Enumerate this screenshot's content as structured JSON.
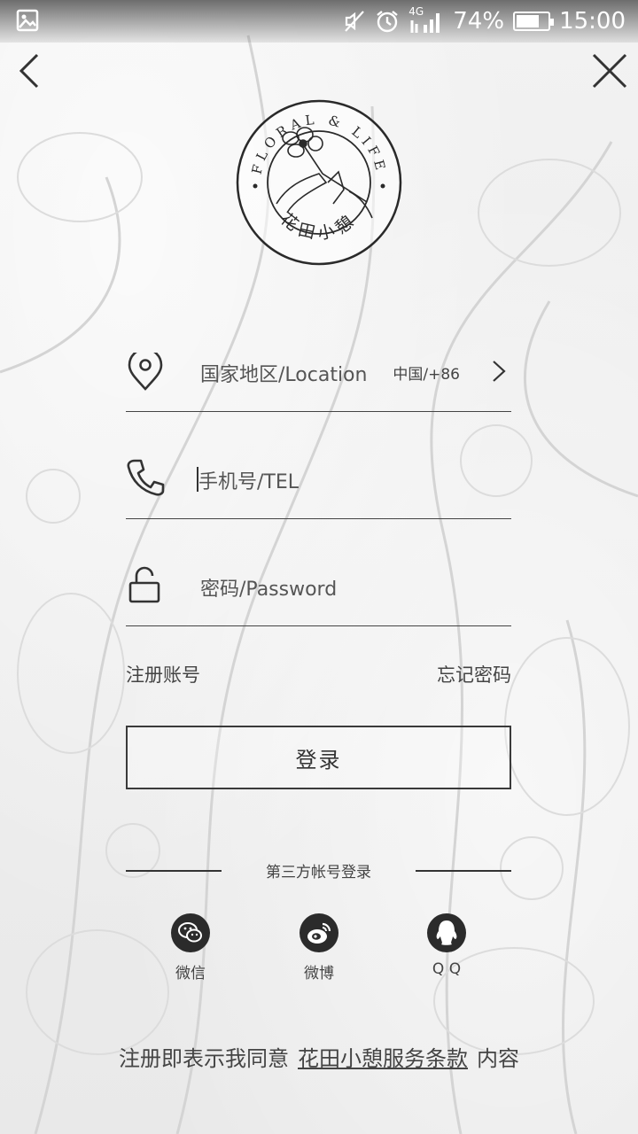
{
  "status_bar": {
    "battery": "74%",
    "battery_level": 0.74,
    "time": "15:00",
    "network": "4G"
  },
  "logo": {
    "ring_text": "FLORAL & LIFE",
    "brand_cn": "花田小憩"
  },
  "form": {
    "location": {
      "label": "国家地区/Location",
      "value": "中国/+86"
    },
    "phone": {
      "placeholder": "手机号/TEL"
    },
    "password": {
      "placeholder": "密码/Password"
    }
  },
  "links": {
    "register": "注册账号",
    "forgot": "忘记密码"
  },
  "login_button": "登录",
  "third_party": {
    "title": "第三方帐号登录",
    "items": [
      {
        "label": "微信",
        "icon": "wechat-icon"
      },
      {
        "label": "微博",
        "icon": "weibo-icon"
      },
      {
        "label": "Q Q",
        "icon": "qq-icon"
      }
    ]
  },
  "terms": {
    "prefix": "注册即表示我同意",
    "link": "花田小憩服务条款",
    "suffix": "内容"
  }
}
